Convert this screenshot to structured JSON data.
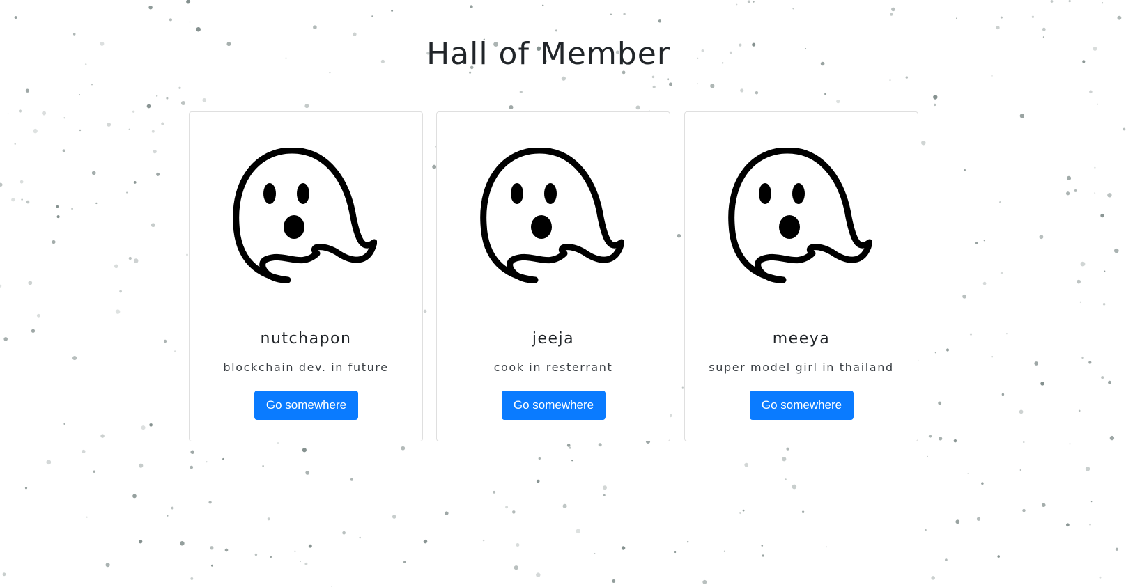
{
  "page": {
    "title": "Hall of Member"
  },
  "members": [
    {
      "name": "nutchapon",
      "description": "blockchain dev. in future",
      "button_label": "Go somewhere",
      "avatar_icon": "ghost-icon"
    },
    {
      "name": "jeeja",
      "description": "cook in resterrant",
      "button_label": "Go somewhere",
      "avatar_icon": "ghost-icon"
    },
    {
      "name": "meeya",
      "description": "super model girl in thailand",
      "button_label": "Go somewhere",
      "avatar_icon": "ghost-icon"
    }
  ],
  "colors": {
    "button": "#0a7bff",
    "background": "#ffffff",
    "speckle": "#7d8a88"
  }
}
